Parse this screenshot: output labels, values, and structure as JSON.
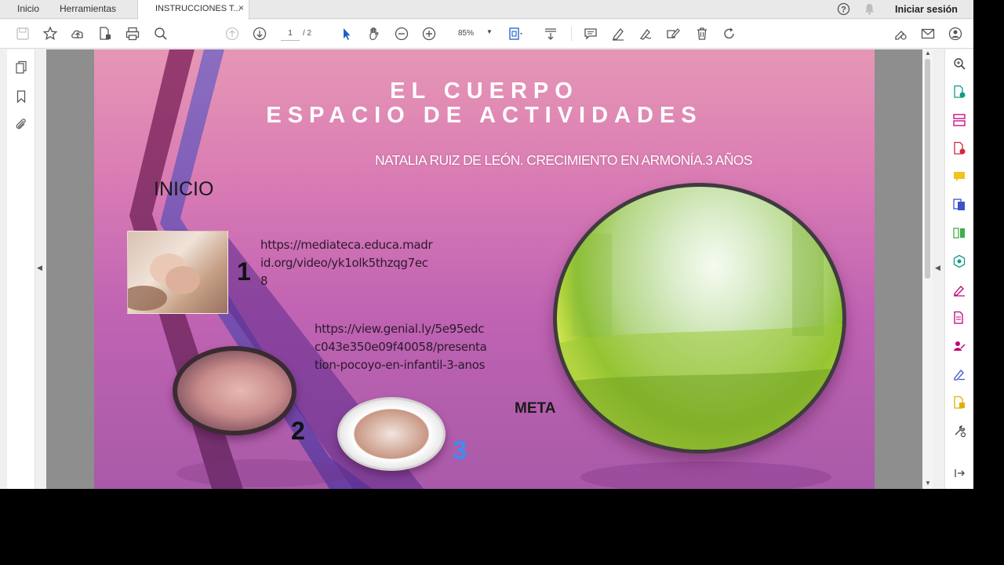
{
  "menubar": {
    "home": "Inicio",
    "tools": "Herramientas",
    "doc_tab": "INSTRUCCIONES T...",
    "close": "×",
    "sign_in": "Iniciar sesión"
  },
  "toolbar": {
    "page_current": "1",
    "page_total": "/ 2",
    "zoom": "85%"
  },
  "slide": {
    "title_line1": "EL CUERPO",
    "title_line2": "ESPACIO DE ACTIVIDADES",
    "subtitle": "NATALIA RUIZ DE LEÓN. CRECIMIENTO EN ARMONÍA.3 AÑOS",
    "start_label": "INICIO",
    "goal_label": "META",
    "num1": "1",
    "num2": "2",
    "num3": "3",
    "url1": "https://mediateca.educa.madrid.org/video/yk1olk5thzqg7ec8",
    "url2": "https://view.genial.ly/5e95edcc043e350e09f40058/presentation-pocoyo-en-infantil-3-anos"
  },
  "colors": {
    "slide_top": "#e697b5",
    "slide_bottom": "#a85aa8",
    "num3": "#3d8df2",
    "accent_icon": "#c2007a"
  }
}
